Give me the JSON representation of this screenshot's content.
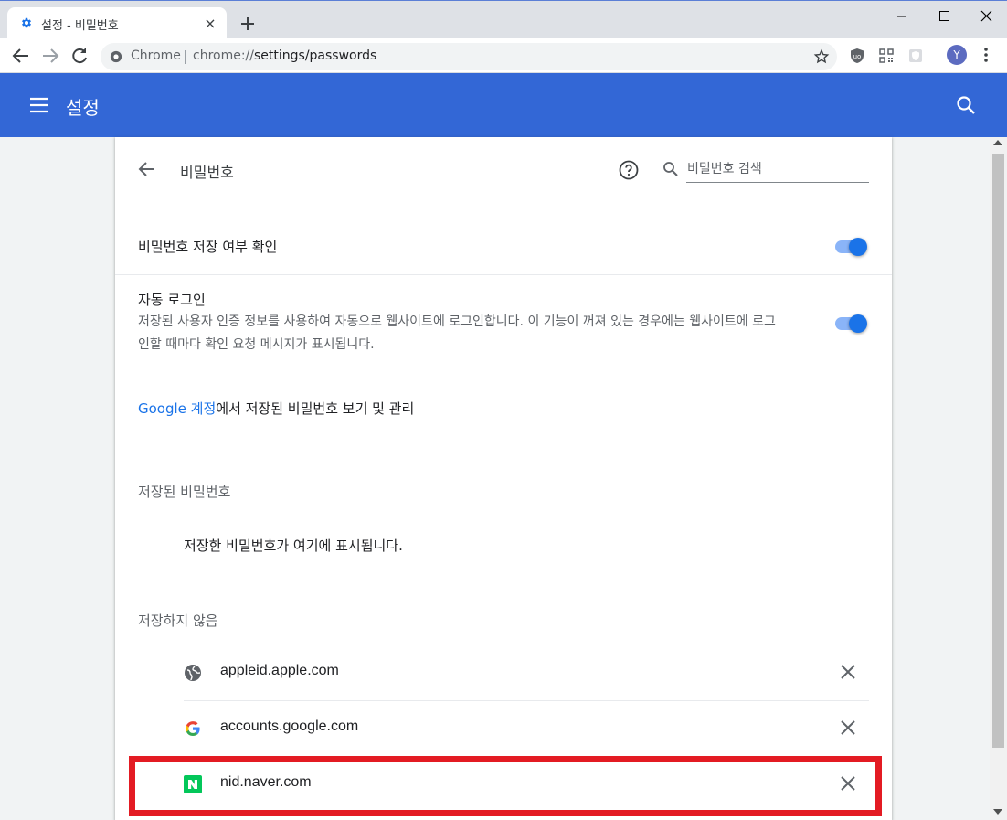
{
  "tab": {
    "title": "설정 - 비밀번호",
    "close": "×"
  },
  "omnibox": {
    "chip": "Chrome",
    "url_prefix": "chrome://",
    "url_path": "settings/passwords"
  },
  "profile": {
    "initial": "Y"
  },
  "header": {
    "title": "설정"
  },
  "passwords": {
    "title": "비밀번호",
    "search_placeholder": "비밀번호 검색",
    "offer_to_save": {
      "label": "비밀번호 저장 여부 확인",
      "enabled": true
    },
    "auto_signin": {
      "label": "자동 로그인",
      "description": "저장된 사용자 인증 정보를 사용하여 자동으로 웹사이트에 로그인합니다. 이 기능이 꺼져 있는 경우에는 웹사이트에 로그인할 때마다 확인 요청 메시지가 표시됩니다.",
      "enabled": true
    },
    "google_account_link": "Google 계정",
    "google_account_suffix": "에서 저장된 비밀번호 보기 및 관리",
    "saved_heading": "저장된 비밀번호",
    "saved_empty": "저장한 비밀번호가 여기에 표시됩니다.",
    "never_saved_heading": "저장하지 않음",
    "never_saved": [
      {
        "host": "appleid.apple.com",
        "icon": "globe-icon"
      },
      {
        "host": "accounts.google.com",
        "icon": "google-icon"
      },
      {
        "host": "nid.naver.com",
        "icon": "naver-icon"
      }
    ]
  },
  "colors": {
    "header": "#3367d6",
    "toggle_on": "#1a73e8",
    "link": "#1a73e8",
    "highlight": "#e31b23",
    "naver": "#03c75a"
  }
}
